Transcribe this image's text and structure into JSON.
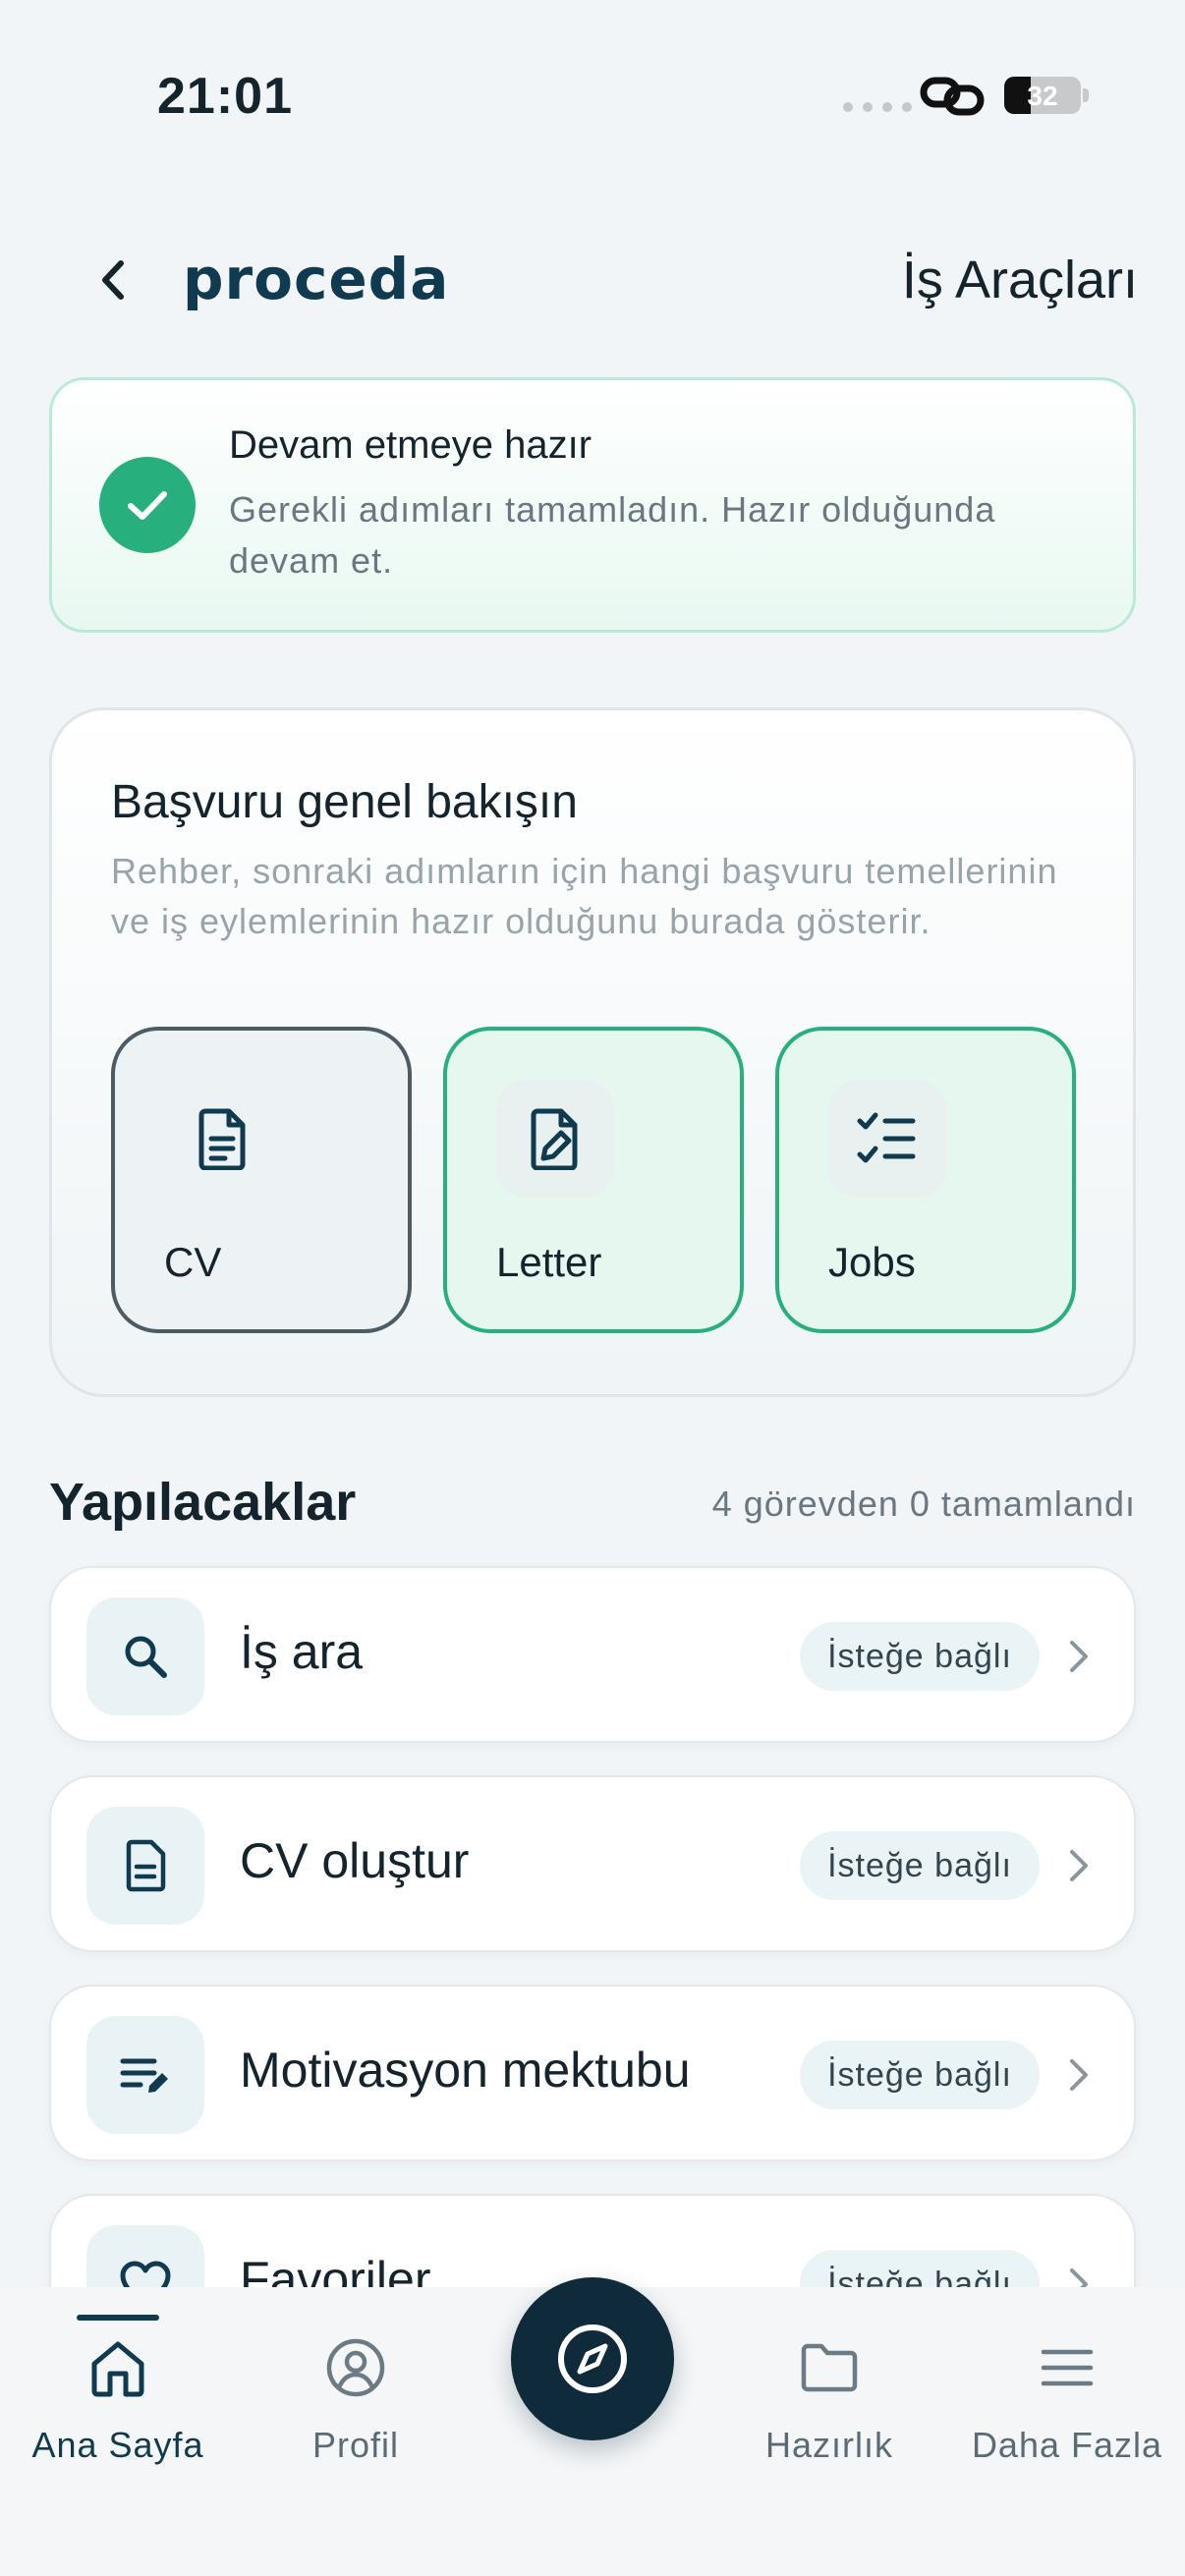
{
  "status_bar": {
    "time": "21:01",
    "battery": "32"
  },
  "header": {
    "logo": "proceda",
    "title": "İş Araçları"
  },
  "ready_card": {
    "title": "Devam etmeye hazır",
    "text": "Gerekli adımları tamamladın. Hazır olduğunda devam et."
  },
  "overview": {
    "title": "Başvuru genel bakışın",
    "text": "Rehber, sonraki adımların için hangi başvuru temellerinin ve iş eylemlerinin hazır olduğunu burada gösterir.",
    "tiles": [
      {
        "label": "CV",
        "icon": "document-icon",
        "state": "neutral"
      },
      {
        "label": "Letter",
        "icon": "letter-edit-icon",
        "state": "ready"
      },
      {
        "label": "Jobs",
        "icon": "checklist-icon",
        "state": "ready"
      }
    ]
  },
  "tasks": {
    "title": "Yapılacaklar",
    "count_text": "4 görevden 0 tamamlandı",
    "items": [
      {
        "label": "İş ara",
        "badge": "İsteğe bağlı",
        "icon": "search-icon"
      },
      {
        "label": "CV oluştur",
        "badge": "İsteğe bağlı",
        "icon": "document-icon"
      },
      {
        "label": "Motivasyon mektubu",
        "badge": "İsteğe bağlı",
        "icon": "edit-notes-icon"
      },
      {
        "label": "Favoriler",
        "badge": "İsteğe bağlı",
        "icon": "heart-icon"
      }
    ]
  },
  "bottom_nav": {
    "items": [
      {
        "label": "Ana Sayfa",
        "icon": "home-icon",
        "active": true
      },
      {
        "label": "Profil",
        "icon": "profile-icon",
        "active": false
      },
      {
        "label": "Hazırlık",
        "icon": "folder-icon",
        "active": false
      },
      {
        "label": "Daha Fazla",
        "icon": "menu-icon",
        "active": false
      }
    ],
    "fab_icon": "compass-icon"
  },
  "colors": {
    "brand": "#0f3a4f",
    "success": "#27b07e",
    "background": "#f2f5f7"
  }
}
